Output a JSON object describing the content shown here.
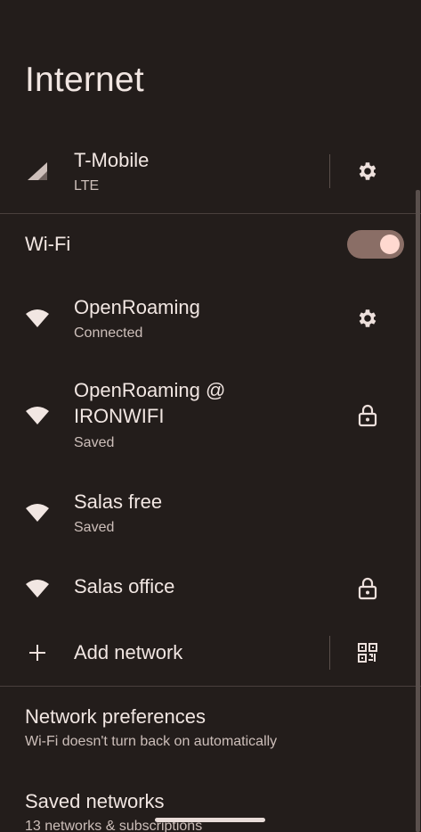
{
  "page": {
    "title": "Internet"
  },
  "mobile": {
    "carrier": "T-Mobile",
    "type": "LTE"
  },
  "wifi": {
    "label": "Wi-Fi",
    "enabled": true
  },
  "networks": [
    {
      "name": "OpenRoaming",
      "status": "Connected"
    },
    {
      "name": "OpenRoaming @",
      "name2": "IRONWIFI",
      "status": "Saved"
    },
    {
      "name": "Salas free",
      "status": "Saved"
    },
    {
      "name": "Salas office",
      "status": ""
    }
  ],
  "add_network": {
    "label": "Add network"
  },
  "preferences": [
    {
      "title": "Network preferences",
      "subtitle": "Wi-Fi doesn't turn back on automatically"
    },
    {
      "title": "Saved networks",
      "subtitle": "13 networks & subscriptions"
    }
  ],
  "colors": {
    "background": "#231d1b",
    "toggle_track": "#8a6e66",
    "toggle_knob": "#ffd9d0",
    "text": "#f1e6e2"
  }
}
